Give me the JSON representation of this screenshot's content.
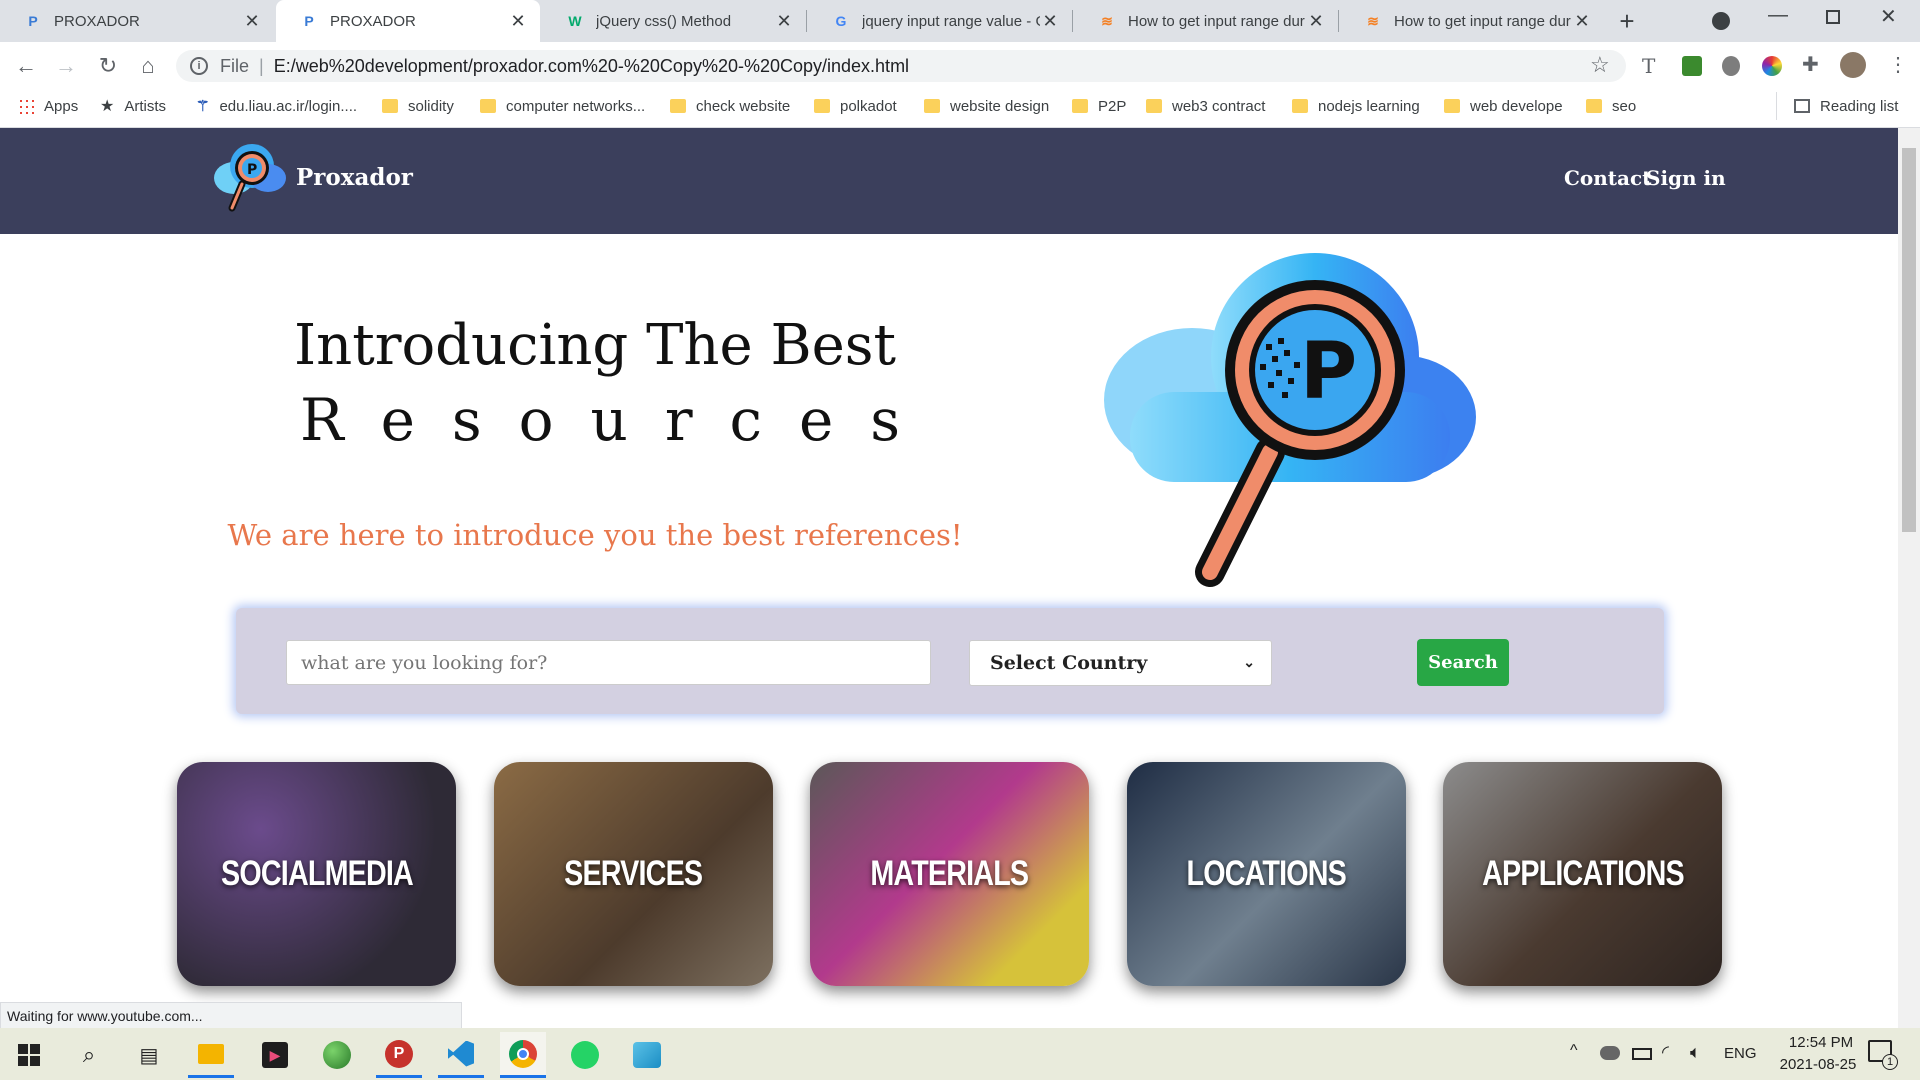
{
  "tabs": [
    {
      "title": "PROXADOR",
      "favicon": "proxador-icon"
    },
    {
      "title": "PROXADOR",
      "favicon": "proxador-icon",
      "active": true
    },
    {
      "title": "jQuery css() Method",
      "favicon": "w3schools-icon"
    },
    {
      "title": "jquery input range value - G",
      "favicon": "google-icon"
    },
    {
      "title": "How to get input range dur",
      "favicon": "stackoverflow-icon"
    },
    {
      "title": "How to get input range dur",
      "favicon": "stackoverflow-icon"
    }
  ],
  "omnibox": {
    "scheme": "File",
    "url": "E:/web%20development/proxador.com%20-%20Copy%20-%20Copy/index.html"
  },
  "bookmarks": {
    "items": [
      "Apps",
      "Artists",
      "edu.liau.ac.ir/login....",
      "solidity",
      "computer networks...",
      "check website",
      "polkadot",
      "website design",
      "P2P",
      "web3 contract",
      "nodejs learning",
      "web develope",
      "seo"
    ],
    "reading_list": "Reading list"
  },
  "site": {
    "brand": "Proxador",
    "nav": {
      "contact": "Contact",
      "signin": "Sign in"
    },
    "hero": {
      "title": "Introducing The Best",
      "word_letters": [
        "R",
        "e",
        "s",
        "o",
        "u",
        "r",
        "c",
        "e",
        "s"
      ],
      "tagline": "We are here to introduce you the best references!"
    },
    "search": {
      "placeholder": "what are you looking for?",
      "country": "Select Country",
      "button": "Search"
    },
    "categories": [
      {
        "label": "SOCIALMEDIA",
        "color": "#3a3548"
      },
      {
        "label": "SERVICES",
        "color": "#5a4a38"
      },
      {
        "label": "MATERIALS",
        "color": "#7a3d6a"
      },
      {
        "label": "LOCATIONS",
        "color": "#2d3a4e"
      },
      {
        "label": "APPLICATIONS",
        "color": "#3e352f"
      }
    ]
  },
  "status": "Waiting for www.youtube.com...",
  "taskbar": {
    "lang": "ENG",
    "time": "12:54 PM",
    "date": "2021-08-25",
    "notif_count": "1"
  },
  "colors": {
    "header": "#3b3f5c",
    "accent": "#e8774c",
    "search_btn": "#28a745"
  }
}
